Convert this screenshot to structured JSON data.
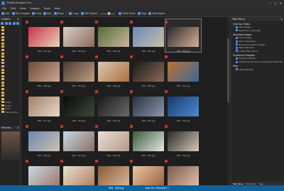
{
  "window": {
    "title": "Photo Manager Pro",
    "controls": [
      "—",
      "□",
      "✕"
    ]
  },
  "menu": [
    "File",
    "Edit",
    "View",
    "Images",
    "Tools",
    "Help"
  ],
  "toolbar": [
    {
      "label": "Add",
      "icon": "add-icon"
    },
    {
      "label": "Find Images",
      "icon": "find-icon"
    },
    {
      "label": "Crop",
      "icon": "crop-icon"
    },
    {
      "label": "Edit",
      "icon": "edit-icon"
    },
    {
      "label": "Share",
      "icon": "share-icon"
    },
    {
      "label": "Copy",
      "icon": "copy-icon"
    },
    {
      "label": "Edit Album",
      "icon": "album-icon"
    },
    {
      "label": "Slide Show",
      "icon": "slideshow-icon"
    },
    {
      "label": "Tags",
      "icon": "tags-icon"
    },
    {
      "label": "Workspace",
      "icon": "workspace-icon"
    }
  ],
  "folders": {
    "title": "Folders",
    "items": [
      "",
      "",
      "",
      "",
      "",
      "",
      "",
      "",
      "",
      "",
      "",
      "",
      "",
      "",
      "",
      "",
      "",
      "",
      "",
      "",
      "",
      "",
      "",
      "Mobile",
      "Movies",
      "Music",
      "Travel photos"
    ]
  },
  "preview": {
    "title": "Preview"
  },
  "gallery": {
    "rows": [
      [
        {
          "name": "IMG - 001.jpg",
          "c1": "#c8324a",
          "c2": "#e8d2b8"
        },
        {
          "name": "IMG - 002.jpg",
          "c1": "#d8d0c8",
          "c2": "#8a6a5a"
        },
        {
          "name": "IMG - 003.jpg",
          "c1": "#5a6a3a",
          "c2": "#c8b898"
        },
        {
          "name": "IMG - 004.jpg",
          "c1": "#6a8ab8",
          "c2": "#c8c0a8"
        },
        {
          "name": "IMG - 005.jpg",
          "c1": "#2a2a2a",
          "c2": "#d8b098",
          "sel": true
        }
      ],
      [
        {
          "name": "IMG - 006.jpg",
          "c1": "#6a4a3a",
          "c2": "#d0a890"
        },
        {
          "name": "IMG - 007.jpg",
          "c1": "#4a3a30",
          "c2": "#c0a080"
        },
        {
          "name": "IMG - 008.jpg",
          "c1": "#d8c8b0",
          "c2": "#b07040"
        },
        {
          "name": "IMG - 009.jpg",
          "c1": "#1a1a1a",
          "c2": "#8a6a5a"
        },
        {
          "name": "IMG - 010.jpg",
          "c1": "#c07030",
          "c2": "#3a6a98"
        }
      ],
      [
        {
          "name": "IMG - 011.jpg",
          "c1": "#a08068",
          "c2": "#e8d8c8"
        },
        {
          "name": "IMG - 012.jpg",
          "c1": "#0a0a0a",
          "c2": "#3a4a3a"
        },
        {
          "name": "IMG - 013.jpg",
          "c1": "#1a1a1a",
          "c2": "#6a6a6a"
        },
        {
          "name": "IMG - 014.jpg",
          "c1": "#2a3040",
          "c2": "#8a98b0"
        },
        {
          "name": "IMG - 015.jpg",
          "c1": "#1a3a6a",
          "c2": "#4a8ad0"
        }
      ],
      [
        {
          "name": "IMG - 016.jpg",
          "c1": "#6a8ab0",
          "c2": "#d0c0b0"
        },
        {
          "name": "IMG - 017.jpg",
          "c1": "#c8d8e8",
          "c2": "#8a7060"
        },
        {
          "name": "IMG - 018.jpg",
          "c1": "#e8e0d8",
          "c2": "#b89888"
        },
        {
          "name": "IMG - 019.jpg",
          "c1": "#3a5a3a",
          "c2": "#e8e8e8"
        },
        {
          "name": "IMG - 020.jpg",
          "c1": "#2a2a2a",
          "c2": "#d8c8b8"
        }
      ],
      [
        {
          "name": "IMG - 021.jpg",
          "c1": "#c8d8e8",
          "c2": "#a07868"
        },
        {
          "name": "IMG - 022.jpg",
          "c1": "#e8e0d0",
          "c2": "#b08060"
        },
        {
          "name": "IMG - 023.jpg",
          "c1": "#8a5a3a",
          "c2": "#d8b898"
        },
        {
          "name": "IMG - 024.jpg",
          "c1": "#e8c8a0",
          "c2": "#a06040"
        },
        {
          "name": "IMG - 025.jpg",
          "c1": "#7a5a4a",
          "c2": "#e0c0a8"
        }
      ]
    ]
  },
  "taskpanel": {
    "title": "Task Panel",
    "sections": [
      {
        "title": "Common Tasks",
        "items": [
          "Add Images",
          "Search for duplicates"
        ]
      },
      {
        "title": "Selected Images",
        "items": [
          "Find Images",
          "Start Slide Show",
          "Rename and Print images",
          "Batch Rename",
          "Create Web Album"
        ]
      },
      {
        "title": "Customize Program",
        "items": [
          "Program Options",
          "Customize hot-keys or keyboard shortcuts"
        ]
      },
      {
        "title": "Help",
        "items": [
          "User Help Site"
        ]
      }
    ],
    "tabs": [
      "Task Panel",
      "Properties",
      "Tags"
    ]
  },
  "status": {
    "main": "IMG - 005.jpg",
    "selection": "Total 25 | Selected: 1"
  }
}
